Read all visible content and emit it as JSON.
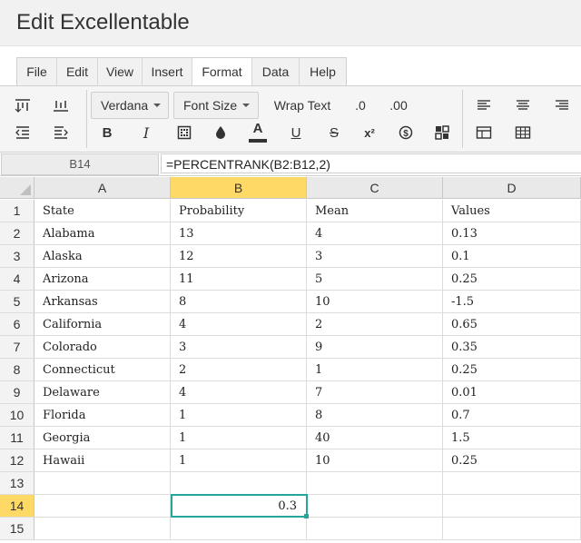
{
  "app": {
    "title": "Edit Excellentable"
  },
  "menu": {
    "tabs": [
      {
        "label": "File"
      },
      {
        "label": "Edit"
      },
      {
        "label": "View"
      },
      {
        "label": "Insert"
      },
      {
        "label": "Format"
      },
      {
        "label": "Data"
      },
      {
        "label": "Help"
      }
    ],
    "active": "Format"
  },
  "toolbar": {
    "font_family": "Verdana",
    "font_size": "Font Size",
    "wrap_text": "Wrap Text",
    "decimal_decrease": ".0",
    "decimal_increase": ".00",
    "bold": "B",
    "italic": "I",
    "text_color": "A",
    "underline": "U",
    "strikethrough": "S",
    "superscript": "x²",
    "currency": "$",
    "accent_color": "#26a69a",
    "highlight_color": "#ffd966"
  },
  "formula_bar": {
    "cell_ref": "B14",
    "formula": "=PERCENTRANK(B2:B12,2)"
  },
  "sheet": {
    "columns": [
      "A",
      "B",
      "C",
      "D"
    ],
    "selected_column": "B",
    "selected_row": "14",
    "rows": [
      {
        "num": "1",
        "cells": [
          "State",
          "Probability",
          "Mean",
          "Values"
        ]
      },
      {
        "num": "2",
        "cells": [
          "Alabama",
          "13",
          "4",
          "0.13"
        ]
      },
      {
        "num": "3",
        "cells": [
          "Alaska",
          "12",
          "3",
          "0.1"
        ]
      },
      {
        "num": "4",
        "cells": [
          "Arizona",
          "11",
          "5",
          "0.25"
        ]
      },
      {
        "num": "5",
        "cells": [
          "Arkansas",
          "8",
          "10",
          "-1.5"
        ]
      },
      {
        "num": "6",
        "cells": [
          "California",
          "4",
          "2",
          "0.65"
        ]
      },
      {
        "num": "7",
        "cells": [
          "Colorado",
          "3",
          "9",
          "0.35"
        ]
      },
      {
        "num": "8",
        "cells": [
          "Connecticut",
          "2",
          "1",
          "0.25"
        ]
      },
      {
        "num": "9",
        "cells": [
          "Delaware",
          "4",
          "7",
          "0.01"
        ]
      },
      {
        "num": "10",
        "cells": [
          "Florida",
          "1",
          "8",
          "0.7"
        ]
      },
      {
        "num": "11",
        "cells": [
          "Georgia",
          "1",
          "40",
          "1.5"
        ]
      },
      {
        "num": "12",
        "cells": [
          "Hawaii",
          "1",
          "10",
          "0.25"
        ]
      },
      {
        "num": "13",
        "cells": [
          "",
          "",
          "",
          ""
        ]
      },
      {
        "num": "14",
        "cells": [
          "",
          "0.3",
          "",
          ""
        ]
      },
      {
        "num": "15",
        "cells": [
          "",
          "",
          "",
          ""
        ]
      }
    ]
  }
}
